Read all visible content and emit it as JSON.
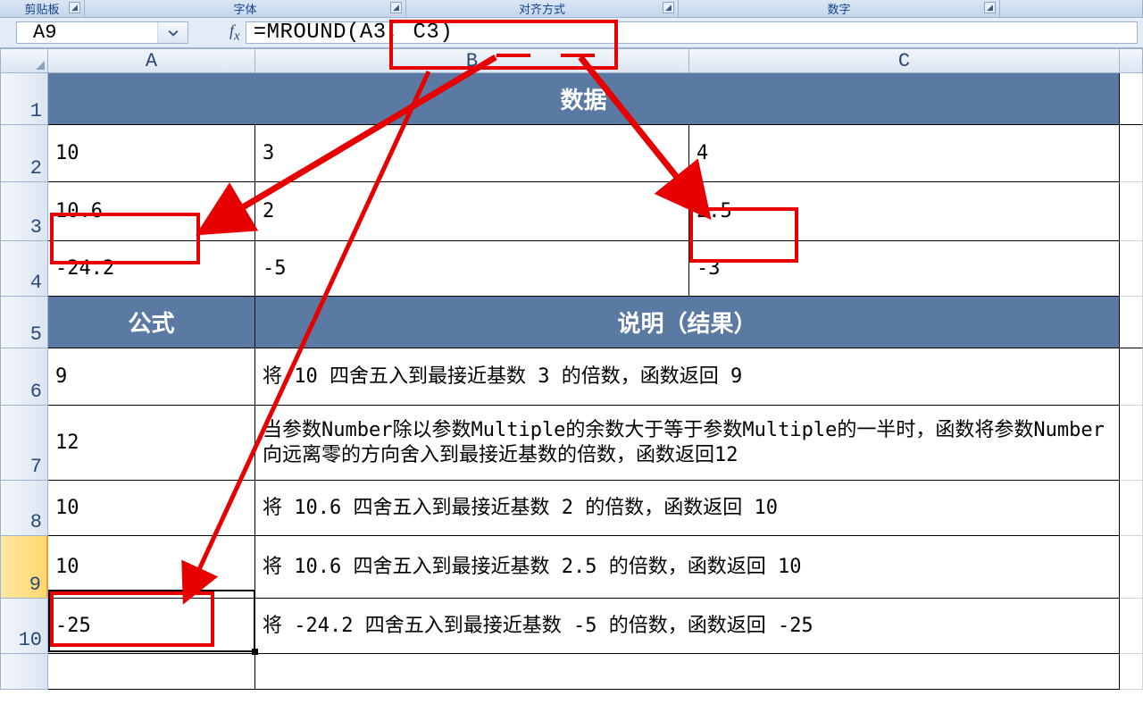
{
  "ribbon": {
    "clipboard": "剪贴板",
    "font": "字体",
    "alignment": "对齐方式",
    "number": "数字"
  },
  "namebox": {
    "value": "A9"
  },
  "formula_bar": {
    "value": "=MROUND(A3, C3)"
  },
  "columns": {
    "A": "A",
    "B": "B",
    "C": "C"
  },
  "row_numbers": [
    "1",
    "2",
    "3",
    "4",
    "5",
    "6",
    "7",
    "8",
    "9",
    "10"
  ],
  "sheet": {
    "header_data": "数据",
    "r2": {
      "A": "10",
      "B": "3",
      "C": "4"
    },
    "r3": {
      "A": "10.6",
      "B": "2",
      "C": "2.5"
    },
    "r4": {
      "A": "-24.2",
      "B": "-5",
      "C": "-3"
    },
    "header_formula": "公式",
    "header_desc": "说明（结果）",
    "r6": {
      "A": "9",
      "desc": "将 10 四舍五入到最接近基数 3 的倍数，函数返回 9"
    },
    "r7": {
      "A": "12",
      "desc": "当参数Number除以参数Multiple的余数大于等于参数Multiple的一半时，函数将参数Number向远离零的方向舍入到最接近基数的倍数，函数返回12"
    },
    "r8": {
      "A": "10",
      "desc": "将 10.6 四舍五入到最接近基数 2 的倍数，函数返回 10"
    },
    "r9": {
      "A": "10",
      "desc": "将 10.6 四舍五入到最接近基数 2.5 的倍数，函数返回 10"
    },
    "r10": {
      "A": "-25",
      "desc": "将 -24.2 四舍五入到最接近基数 -5 的倍数，函数返回 -25"
    }
  }
}
